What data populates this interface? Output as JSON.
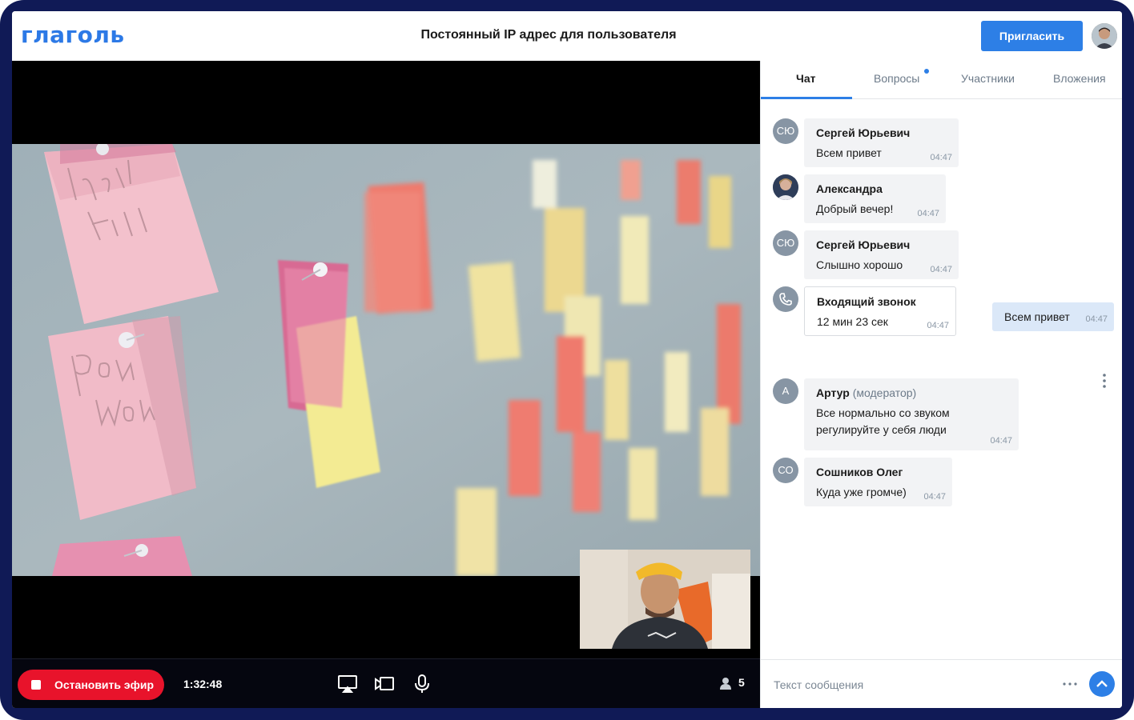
{
  "app": {
    "logo": "глаголь",
    "title": "Постоянный IP адрес для пользователя",
    "invite_label": "Пригласить"
  },
  "broadcast": {
    "stop_label": "Остановить эфир",
    "timer": "1:32:48",
    "viewers": "5"
  },
  "tabs": [
    {
      "label": "Чат",
      "active": true
    },
    {
      "label": "Вопросы",
      "active": false,
      "has_dot": true
    },
    {
      "label": "Участники",
      "active": false
    },
    {
      "label": "Вложения",
      "active": false
    }
  ],
  "messages": [
    {
      "initials": "СЮ",
      "name": "Сергей Юрьевич",
      "text": "Всем привет",
      "time": "04:47"
    },
    {
      "initials": "",
      "name": "Александра",
      "text": "Добрый вечер!",
      "time": "04:47"
    },
    {
      "initials": "СЮ",
      "name": "Сергей Юрьевич",
      "text": "Слышно хорошо",
      "time": "04:47"
    },
    {
      "icon": "phone-icon",
      "name": "Входящий звонок",
      "text": "12 мин 23 сек",
      "time": "04:47"
    },
    {
      "initials": "А",
      "name": "Артур",
      "role": "(модератор)",
      "text_line1": "Все нормально со звуком",
      "text_line2": "регулируйте у себя люди",
      "time": "04:47"
    },
    {
      "initials": "СО",
      "name": "Сошников Олег",
      "text": "Куда уже громче)",
      "time": "04:47"
    }
  ],
  "own_message": {
    "text": "Всем привет",
    "time": "04:47"
  },
  "composer": {
    "placeholder": "Текст сообщения"
  },
  "colors": {
    "accent": "#2d7fe6",
    "stop": "#e8132b",
    "frame": "#101a56"
  }
}
